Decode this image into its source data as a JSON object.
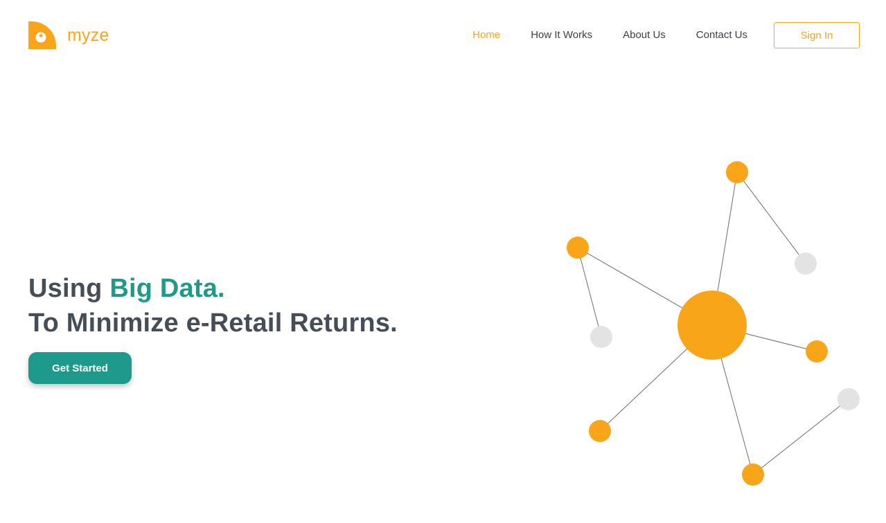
{
  "brand": {
    "name": "myze",
    "accent_color": "#f9a51a",
    "primary_color": "#1e9a8a"
  },
  "nav": {
    "items": [
      {
        "label": "Home",
        "active": true
      },
      {
        "label": "How It Works",
        "active": false
      },
      {
        "label": "About Us",
        "active": false
      },
      {
        "label": "Contact Us",
        "active": false
      }
    ],
    "sign_in_label": "Sign In"
  },
  "hero": {
    "headline_prefix": "Using ",
    "headline_accent": "Big Data.",
    "headline_line2": "To Minimize e-Retail Returns.",
    "cta_label": "Get Started"
  },
  "network": {
    "node_color": "#f9a51a",
    "muted_node_color": "#e3e3e3",
    "edge_color": "#6b6b6b"
  }
}
